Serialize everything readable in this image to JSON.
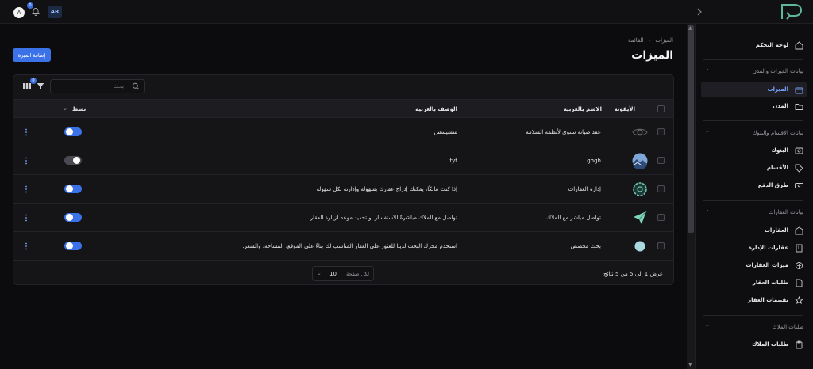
{
  "topbar": {
    "avatar_letter": "A",
    "notifications_count": "0",
    "language": "AR"
  },
  "sidebar": {
    "dashboard": "لوحة التحكم",
    "section1": "بيانات الميزات والمدن",
    "features": "الميزات",
    "cities": "المدن",
    "section2": "بيانات الأقسام والبنوك",
    "banks": "البنوك",
    "departments": "الأقسام",
    "payment_methods": "طرق الدفع",
    "section3": "بيانات العقارات",
    "properties": "العقارات",
    "managed_properties": "عقارات الإدارة",
    "property_features": "ميزات العقارات",
    "property_requests": "طلبات العقار",
    "property_ratings": "تقييمات العقار",
    "section4": "طلبات الملاك",
    "owner_requests": "طلبات الملاك"
  },
  "breadcrumb": {
    "parent": "الميزات",
    "current": "القائمة"
  },
  "page_title": "الميزات",
  "add_button": "إضافة الميزة",
  "toolbar": {
    "search_placeholder": "بحث",
    "filter_count": "0"
  },
  "table": {
    "headers": {
      "icon": "الأيقونة",
      "name": "الاسم بالعربية",
      "description": "الوصف بالعربية",
      "active": "نشط"
    },
    "rows": [
      {
        "name": "عقد صيانة سنوي لأنظمة السلامة",
        "description": "شسيسش",
        "active": true,
        "icon": "eye-icon"
      },
      {
        "name": "ghgh",
        "description": "tyt",
        "active": false,
        "icon": "landscape-photo"
      },
      {
        "name": "إدارة العقارات",
        "description": "إذا كنت مالكًا، يمكنك إدراج عقارك بسهولة وإدارته بكل سهولة",
        "active": true,
        "icon": "gear-badge-icon"
      },
      {
        "name": "تواصل مباشر مع الملاك",
        "description": "تواصل مع الملاك مباشرةً للاستفسار أو تحديد موعد لزيارة العقار.",
        "active": true,
        "icon": "send-icon"
      },
      {
        "name": "بحث مخصص",
        "description": "استخدم محرك البحث لدينا للعثور على العقار المناسب لك بناءً على الموقع، المساحة، والسعر.",
        "active": true,
        "icon": "circle-icon"
      }
    ]
  },
  "footer": {
    "summary": "عرض 1 إلى 5 من 5 نتائج",
    "per_page_label": "لكل صفحة",
    "per_page_value": "10"
  },
  "colors": {
    "accent": "#3b72e8",
    "background": "#0c0c0e",
    "card": "#151518"
  }
}
